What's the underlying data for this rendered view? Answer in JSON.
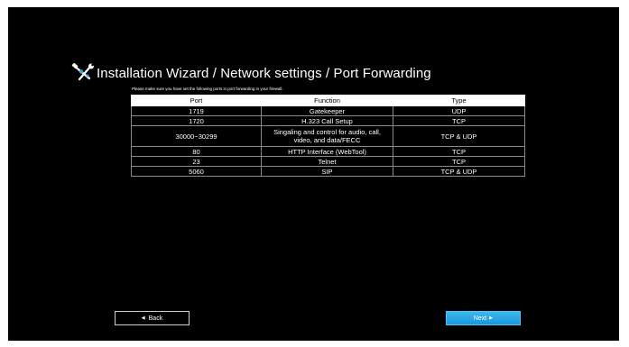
{
  "wizard": {
    "title": "Installation Wizard / Network settings / Port Forwarding",
    "icon": "wrench-screwdriver-icon",
    "notice": "Please make sure you have set the following ports in port forwarding in your firewall."
  },
  "table": {
    "headers": [
      "Port",
      "Function",
      "Type"
    ],
    "rows": [
      {
        "port": "1719",
        "function": "Gatekeeper",
        "type": "UDP"
      },
      {
        "port": "1720",
        "function": "H.323 Call Setup",
        "type": "TCP"
      },
      {
        "port": "30000~30299",
        "function": "Singaling and control for audio, call, video, and data/FECC",
        "type": "TCP & UDP"
      },
      {
        "port": "80",
        "function": "HTTP Interface (WebTool)",
        "type": "TCP"
      },
      {
        "port": "23",
        "function": "Telnet",
        "type": "TCP"
      },
      {
        "port": "5060",
        "function": "SIP",
        "type": "TCP & UDP"
      }
    ]
  },
  "nav": {
    "back_label": "Back",
    "next_label": "Next",
    "back_arrow": "◀",
    "next_arrow": "▶"
  },
  "colors": {
    "background": "#000000",
    "next_button": "#2aa8e6",
    "table_border": "#8a8a8a"
  }
}
